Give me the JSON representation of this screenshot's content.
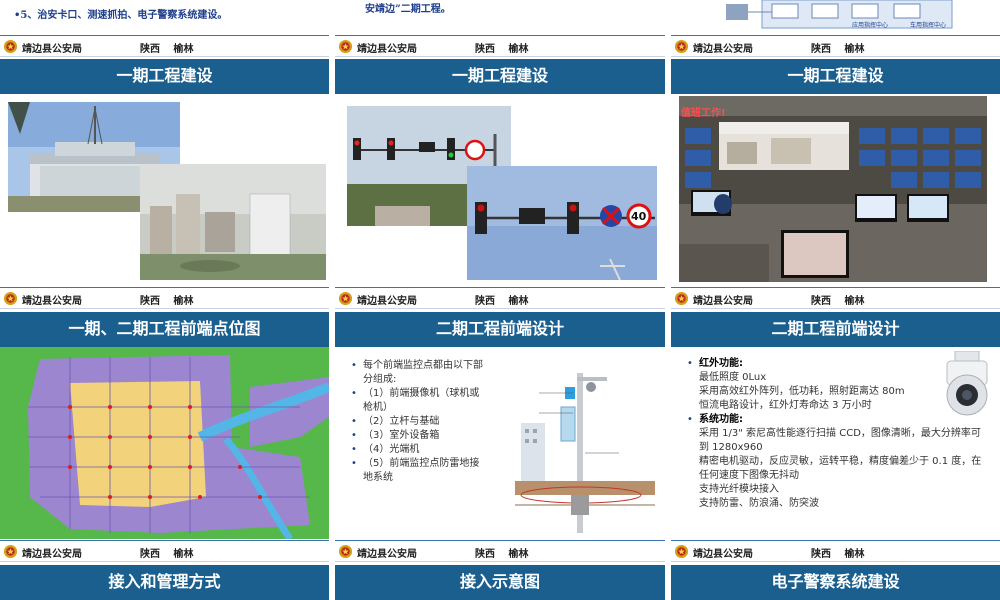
{
  "top": {
    "left_text": "•5、治安卡口、测速抓拍、电子警察系统建设。",
    "mid_text": "安靖边”二期工程。"
  },
  "footer": {
    "agency": "靖边县公安局",
    "region": "陕西 榆林"
  },
  "slides": [
    {
      "title": "一期工程建设"
    },
    {
      "title": "一期工程建设"
    },
    {
      "title": "一期工程建设"
    },
    {
      "title": "一期、二期工程前端点位图"
    },
    {
      "title": "二期工程前端设计"
    },
    {
      "title": "二期工程前端设计"
    },
    {
      "title": "接入和管理方式"
    },
    {
      "title": "接入示意图"
    },
    {
      "title": "电子警察系统建设"
    }
  ],
  "speed_sign": "40",
  "wall_banner": "值班工作!",
  "top_diagram_labels": [
    "应用指挥中心",
    "车用指挥中心"
  ],
  "front_end_list": [
    {
      "text": "每个前端监控点都由以下部分组成:",
      "sub": false
    },
    {
      "text": "（1）前端摄像机（球机或枪机）",
      "sub": false
    },
    {
      "text": "（2）立杆与基础",
      "sub": false
    },
    {
      "text": "（3）室外设备箱",
      "sub": false
    },
    {
      "text": "（4）光端机",
      "sub": false
    },
    {
      "text": "（5）前端监控点防雷地接地系统",
      "sub": false
    }
  ],
  "camera_spec": {
    "ir_heading": "红外功能:",
    "ir_lines": [
      "最低照度 0Lux",
      "采用高效红外阵列，低功耗，照射距离达 80m",
      "恒流电路设计，红外灯寿命达 3 万小时"
    ],
    "sys_heading": "系统功能:",
    "sys_lines": [
      "采用 1/3\" 索尼高性能逐行扫描 CCD，图像清晰，最大分辨率可到 1280x960",
      "精密电机驱动，反应灵敏，运转平稳，精度偏差少于 0.1 度，在任何速度下图像无抖动",
      "支持光纤模块接入",
      "支持防雷、防浪涌、防突波"
    ]
  },
  "colors": {
    "title_bar": "#1a5f8e",
    "accent_text": "#1f3f8c",
    "map_purple": "#9b86cf",
    "map_yellow": "#f2d27a",
    "map_green": "#56b84a"
  }
}
